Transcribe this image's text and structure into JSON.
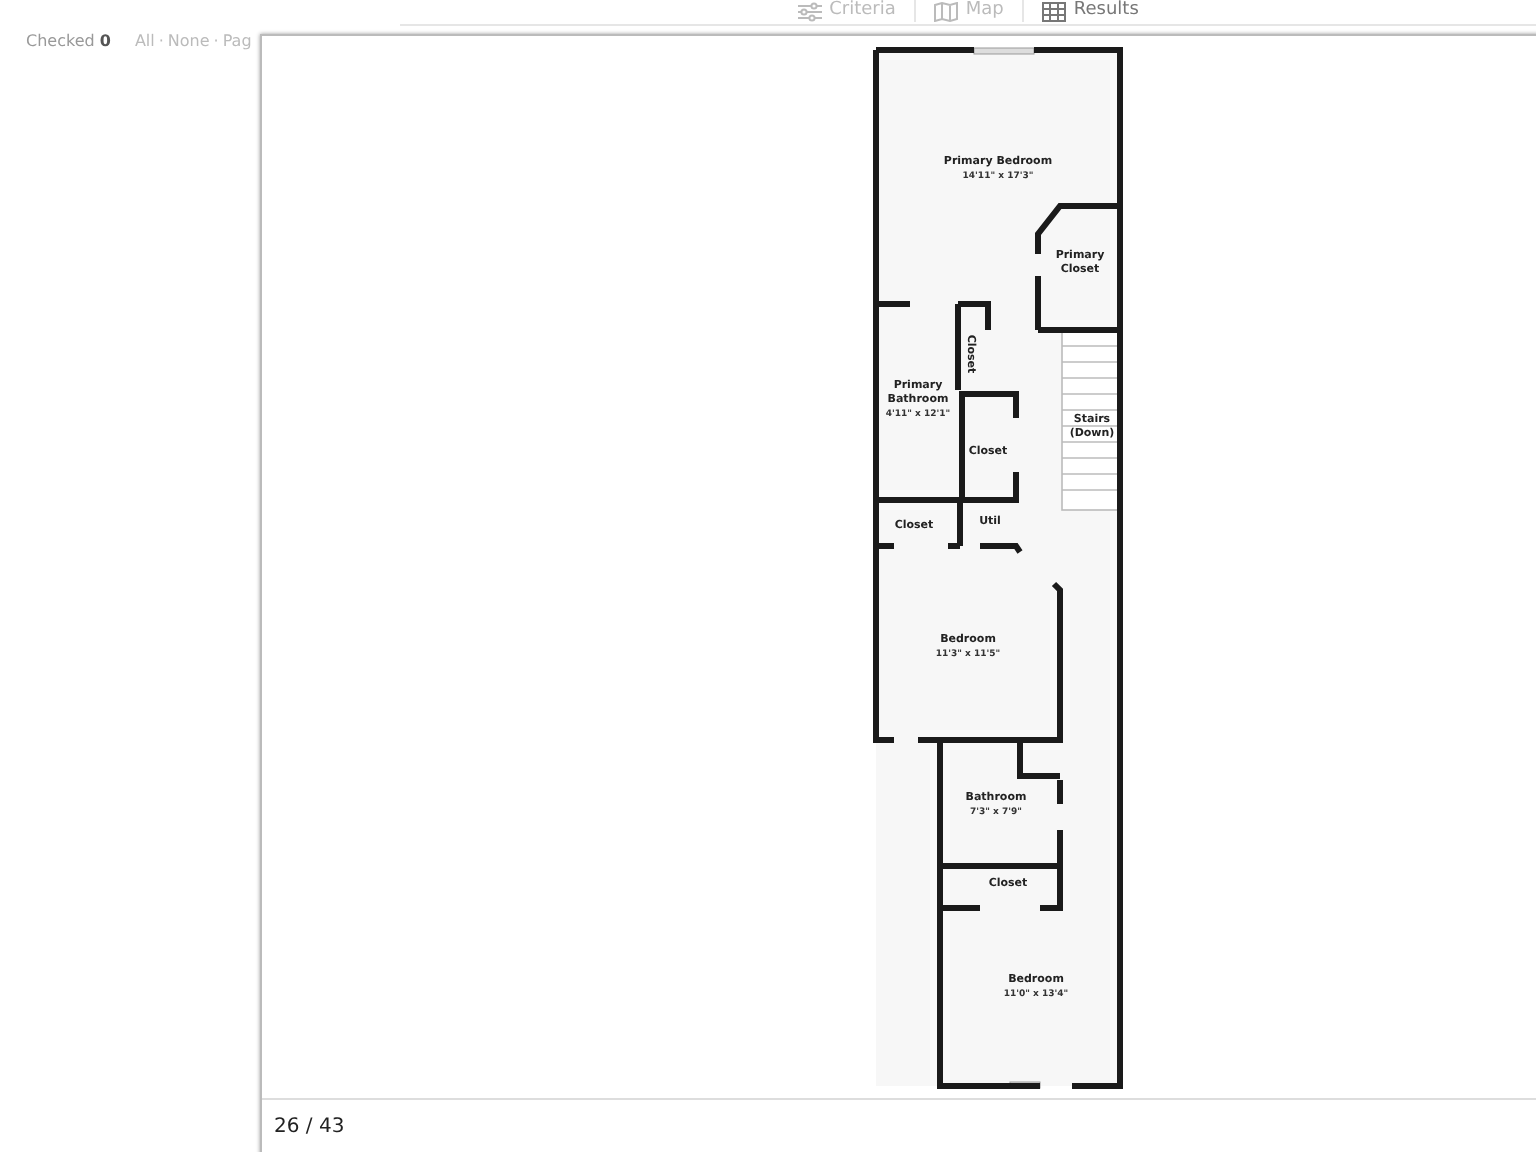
{
  "tabs": [
    {
      "label": "Criteria",
      "selected": false
    },
    {
      "label": "Map",
      "selected": false
    },
    {
      "label": "Results",
      "selected": true
    }
  ],
  "checked": {
    "label": "Checked",
    "count": "0"
  },
  "select_links": [
    "All",
    "None",
    "Pag"
  ],
  "link_separator": "·",
  "viewer": {
    "counter": "26 / 43",
    "rooms": [
      {
        "name": "Primary Bedroom",
        "size": "14'11\" x 17'3\""
      },
      {
        "name": "Primary Closet"
      },
      {
        "name": "Closet",
        "vertical": true
      },
      {
        "name": "Primary Bathroom",
        "size": "4'11\" x 12'1\""
      },
      {
        "name": "Closet"
      },
      {
        "name": "Stairs (Down)"
      },
      {
        "name": "Closet"
      },
      {
        "name": "Util"
      },
      {
        "name": "Bedroom",
        "size": "11'3\" x 11'5\""
      },
      {
        "name": "Bathroom",
        "size": "7'3\" x 7'9\""
      },
      {
        "name": "Closet"
      },
      {
        "name": "Bedroom",
        "size": "11'0\" x 13'4\""
      }
    ]
  }
}
